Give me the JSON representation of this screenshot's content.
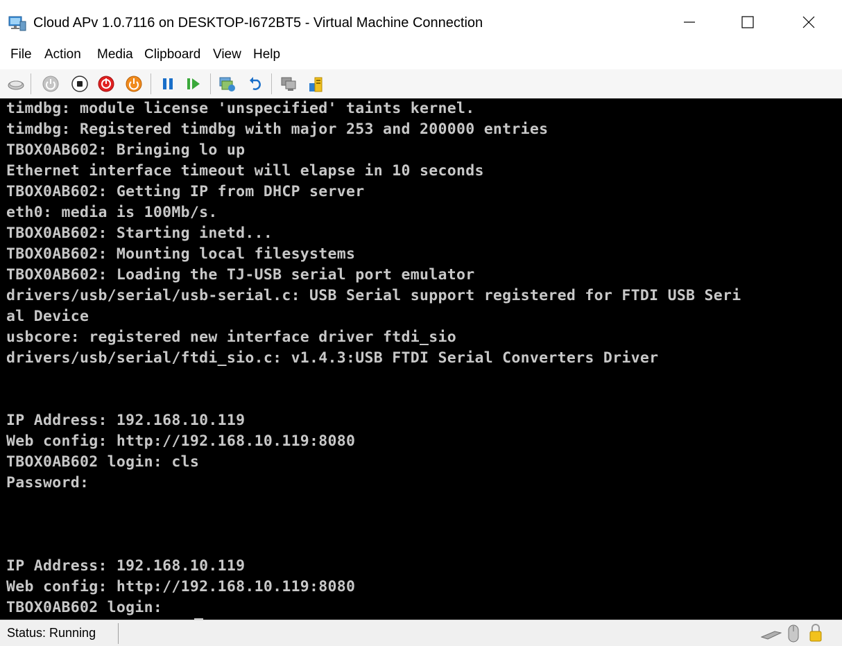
{
  "window": {
    "title": "Cloud APv 1.0.7116 on DESKTOP-I672BT5 - Virtual Machine Connection",
    "app_icon": "vm-connection-icon",
    "controls": [
      "minimize-icon",
      "maximize-icon",
      "close-icon"
    ]
  },
  "menu": {
    "items": [
      "File",
      "Action",
      "Media",
      "Clipboard",
      "View",
      "Help"
    ]
  },
  "toolbar": {
    "buttons": [
      "ctrl-alt-del-icon",
      "start-icon",
      "turn-off-icon",
      "shut-down-icon",
      "power-icon",
      "pause-icon",
      "resume-icon",
      "checkpoint-icon",
      "revert-icon",
      "enhanced-session-icon",
      "share-icon"
    ]
  },
  "console": {
    "lines": [
      "timdbg: module license 'unspecified' taints kernel.",
      "timdbg: Registered timdbg with major 253 and 200000 entries",
      "TBOX0AB602: Bringing lo up",
      "Ethernet interface timeout will elapse in 10 seconds",
      "TBOX0AB602: Getting IP from DHCP server",
      "eth0: media is 100Mb/s.",
      "TBOX0AB602: Starting inetd...",
      "TBOX0AB602: Mounting local filesystems",
      "TBOX0AB602: Loading the TJ-USB serial port emulator",
      "drivers/usb/serial/usb-serial.c: USB Serial support registered for FTDI USB Seri",
      "al Device",
      "usbcore: registered new interface driver ftdi_sio",
      "drivers/usb/serial/ftdi_sio.c: v1.4.3:USB FTDI Serial Converters Driver",
      "",
      "",
      "IP Address: 192.168.10.119",
      "Web config: http://192.168.10.119:8080",
      "TBOX0AB602 login: cls",
      "Password:",
      "",
      "",
      "",
      "IP Address: 192.168.10.119",
      "Web config: http://192.168.10.119:8080",
      "TBOX0AB602 login: "
    ]
  },
  "status": {
    "label": "Status: Running",
    "icons": [
      "keyboard-icon",
      "mouse-icon",
      "lock-icon"
    ]
  },
  "colors": {
    "console_bg": "#000000",
    "console_fg": "#c8c8c8",
    "toolbar_bg": "#f6f6f6",
    "statusbar_bg": "#f0f0f0"
  }
}
